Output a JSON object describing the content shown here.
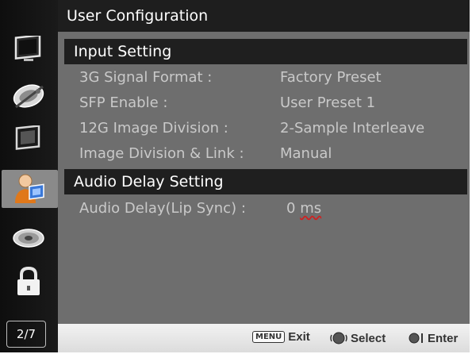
{
  "title": "User Configuration",
  "sidebar": {
    "icons": [
      "monitor-icon",
      "satellite-dish-icon",
      "picture-frame-icon",
      "user-config-icon",
      "disc-icon",
      "lock-icon"
    ],
    "active_index": 3,
    "page_indicator": "2/7"
  },
  "sections": {
    "input": {
      "header": "Input Setting",
      "rows": [
        {
          "label": "3G Signal Format :",
          "value": "Factory Preset"
        },
        {
          "label": "SFP Enable :",
          "value": "User Preset 1"
        },
        {
          "label": "12G Image Division :",
          "value": "2-Sample Interleave"
        },
        {
          "label": "Image Division & Link :",
          "value": "Manual"
        }
      ]
    },
    "audio": {
      "header": "Audio Delay Setting",
      "rows": [
        {
          "label": "Audio Delay(Lip Sync) :",
          "value": "0",
          "unit": "ms"
        }
      ]
    }
  },
  "footer": {
    "menu_key": "MENU",
    "exit_label": "Exit",
    "select_label": "Select",
    "enter_label": "Enter"
  },
  "colors": {
    "panel_bg": "#6e6e6e",
    "header_bg": "#1f1f1f",
    "text_value": "#c9c9c9",
    "footer_bg": "#e8e8e8"
  }
}
